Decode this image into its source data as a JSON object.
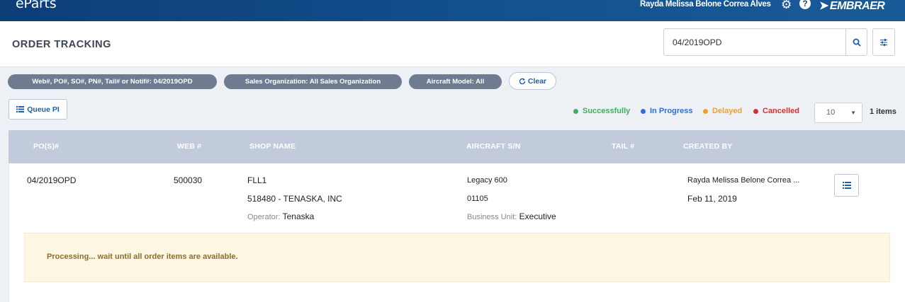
{
  "app": {
    "logo": "eParts",
    "user_name": "Rayda Melissa Belone Correa Alves",
    "brand": "EMBRAER",
    "help_glyph": "?"
  },
  "page": {
    "title": "ORDER TRACKING"
  },
  "search": {
    "value": "04/2019OPD"
  },
  "filters": [
    {
      "label": "Web#, PO#, SO#, PN#, Tail# or Notif#: 04/2019OPD"
    },
    {
      "label": "Sales Organization: All Sales Organization"
    },
    {
      "label": "Aircraft Model: All"
    }
  ],
  "clear_label": "Clear",
  "queue_label": "Queue PI",
  "legend": [
    {
      "label": "Successfully",
      "color": "#3fae5a"
    },
    {
      "label": "In Progress",
      "color": "#2d6fd6"
    },
    {
      "label": "Delayed",
      "color": "#f0a030"
    },
    {
      "label": "Cancelled",
      "color": "#d9302c"
    }
  ],
  "pagination": {
    "page_size": "10",
    "items_count": "1 items"
  },
  "table": {
    "columns": [
      "PO(S)#",
      "WEB #",
      "SHOP NAME",
      "AIRCRAFT S/N",
      "TAIL #",
      "CREATED BY"
    ],
    "rows": [
      {
        "po": "04/2019OPD",
        "web": "500030",
        "shop_code": "FLL1",
        "shop_name": "518480 - TENASKA, INC",
        "operator_label": "Operator:",
        "operator_value": "Tenaska",
        "aircraft_model": "Legacy 600",
        "aircraft_sn": "01105",
        "bu_label": "Business Unit:",
        "bu_value": "Executive",
        "created_by": "Rayda Melissa Belone Correa ...",
        "created_date": "Feb 11, 2019",
        "notice": "Processing... wait until all order items are available."
      }
    ]
  }
}
